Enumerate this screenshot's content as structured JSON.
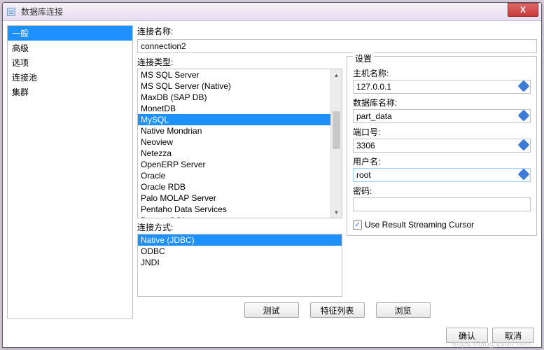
{
  "window": {
    "title": "数据库连接",
    "close": "X"
  },
  "sidebar": {
    "items": [
      {
        "label": "一般",
        "selected": true
      },
      {
        "label": "高级",
        "selected": false
      },
      {
        "label": "选项",
        "selected": false
      },
      {
        "label": "连接池",
        "selected": false
      },
      {
        "label": "集群",
        "selected": false
      }
    ]
  },
  "fields": {
    "conn_name_label": "连接名称:",
    "conn_name_value": "connection2",
    "conn_type_label": "连接类型:",
    "conn_mode_label": "连接方式:"
  },
  "conn_types": [
    "MS SQL Server",
    "MS SQL Server (Native)",
    "MaxDB (SAP DB)",
    "MonetDB",
    "MySQL",
    "Native Mondrian",
    "Neoview",
    "Netezza",
    "OpenERP Server",
    "Oracle",
    "Oracle RDB",
    "Palo MOLAP Server",
    "Pentaho Data Services",
    "PostgreSQL"
  ],
  "conn_type_selected": "MySQL",
  "conn_modes": [
    "Native (JDBC)",
    "ODBC",
    "JNDI"
  ],
  "conn_mode_selected": "Native (JDBC)",
  "settings": {
    "legend": "设置",
    "host_label": "主机名称:",
    "host_value": "127.0.0.1",
    "db_label": "数据库名称:",
    "db_value": "part_data",
    "port_label": "端口号:",
    "port_value": "3306",
    "user_label": "用户名:",
    "user_value": "root",
    "pass_label": "密码:",
    "pass_value": "",
    "streaming_label": "Use Result Streaming Cursor",
    "streaming_checked": true
  },
  "buttons": {
    "test": "测试",
    "features": "特征列表",
    "browse": "浏览",
    "ok": "确认",
    "cancel": "取消"
  },
  "watermark": "https://blog.csdn.net/..."
}
